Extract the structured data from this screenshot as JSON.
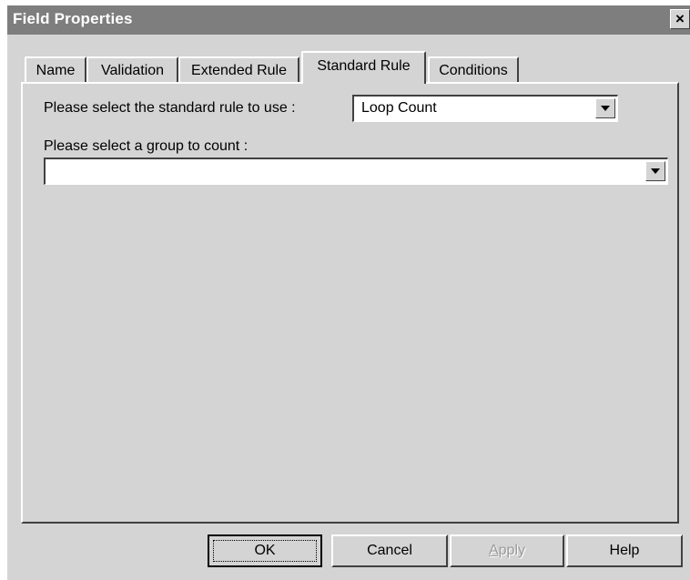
{
  "window": {
    "title": "Field Properties",
    "close_glyph": "×"
  },
  "tabs": [
    {
      "label": "Name"
    },
    {
      "label": "Validation"
    },
    {
      "label": "Extended Rule"
    },
    {
      "label": "Standard Rule",
      "active": true
    },
    {
      "label": "Conditions"
    }
  ],
  "form": {
    "rule_label": "Please select the standard rule to use :",
    "rule_value": "Loop Count",
    "group_label": "Please select a group to count :",
    "group_value": ""
  },
  "buttons": {
    "ok": "OK",
    "cancel": "Cancel",
    "apply_first": "A",
    "apply_rest": "pply",
    "help": "Help"
  },
  "icons": {
    "dropdown": "chevron-down-icon",
    "close": "close-icon"
  },
  "colors": {
    "titlebar": "#7e7e7e",
    "face": "#d4d4d4",
    "field": "#ffffff"
  }
}
